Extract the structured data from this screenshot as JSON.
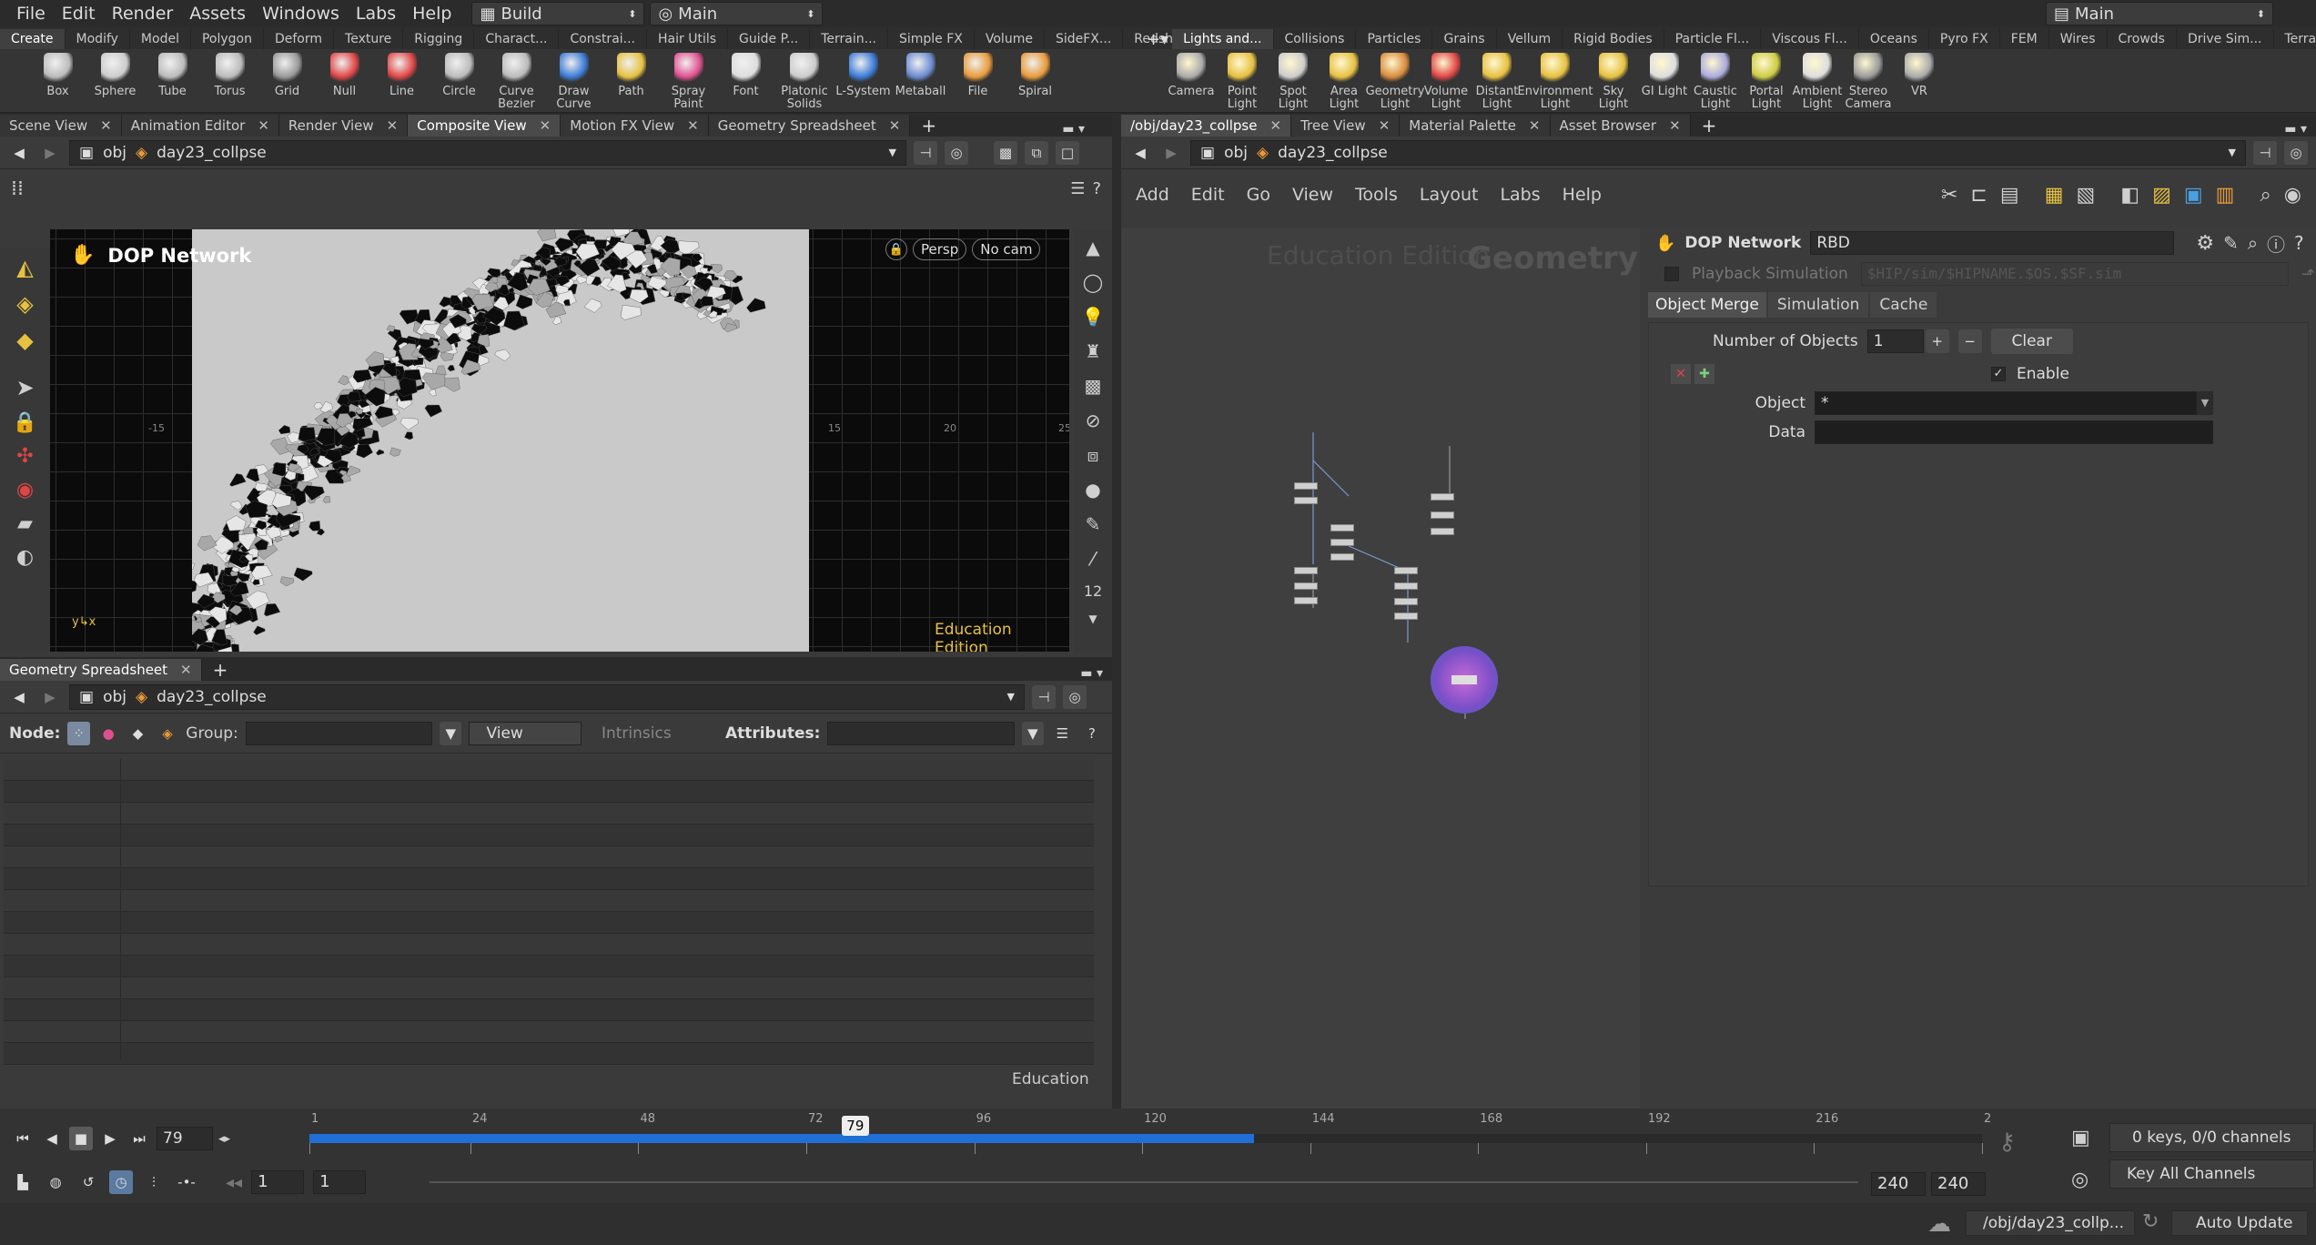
{
  "menubar": {
    "items": [
      "File",
      "Edit",
      "Render",
      "Assets",
      "Windows",
      "Labs",
      "Help"
    ],
    "desktop_build": "Build",
    "desktop_main": "Main",
    "right_desktop": "Main"
  },
  "shelf": {
    "left_tabs": [
      "Create",
      "Modify",
      "Model",
      "Polygon",
      "Deform",
      "Texture",
      "Rigging",
      "Charact...",
      "Constrai...",
      "Hair Utils",
      "Guide P...",
      "Terrain...",
      "Simple FX",
      "Volume",
      "SideFX...",
      "Redshift"
    ],
    "right_tabs": [
      "Lights and...",
      "Collisions",
      "Particles",
      "Grains",
      "Vellum",
      "Rigid Bodies",
      "Particle Fl...",
      "Viscous Fl...",
      "Oceans",
      "Pyro FX",
      "FEM",
      "Wires",
      "Crowds",
      "Drive Sim...",
      "Terrain FX"
    ],
    "left_tools": [
      "Box",
      "Sphere",
      "Tube",
      "Torus",
      "Grid",
      "Null",
      "Line",
      "Circle",
      "Curve Bezier",
      "Draw Curve",
      "Path",
      "Spray Paint",
      "Font",
      "Platonic Solids",
      "L-System",
      "Metaball",
      "File",
      "Spiral"
    ],
    "right_tools": [
      "Camera",
      "Point Light",
      "Spot Light",
      "Area Light",
      "Geometry Light",
      "Volume Light",
      "Distant Light",
      "Environment Light",
      "Sky Light",
      "GI Light",
      "Caustic Light",
      "Portal Light",
      "Ambient Light",
      "Stereo Camera",
      "VR"
    ]
  },
  "left_panes": {
    "tabs": [
      "Scene View",
      "Animation Editor",
      "Render View",
      "Composite View",
      "Motion FX View",
      "Geometry Spreadsheet"
    ],
    "path_obj": "obj",
    "path_node": "day23_collpse"
  },
  "viewport": {
    "title": "DOP Network",
    "persp": "Persp",
    "cam": "No cam",
    "edition": "Education Edition",
    "axis_labels": [
      "-15",
      "15",
      "20",
      "25"
    ]
  },
  "spreadsheet": {
    "tab": "Geometry Spreadsheet",
    "path_obj": "obj",
    "path_node": "day23_collpse",
    "node_label": "Node:",
    "group_label": "Group:",
    "view_label": "View",
    "intrinsics_label": "Intrinsics",
    "attributes_label": "Attributes:",
    "edition": "Education"
  },
  "right_panes": {
    "tabs": [
      "/obj/day23_collpse",
      "Tree View",
      "Material Palette",
      "Asset Browser"
    ],
    "path_obj": "obj",
    "path_node": "day23_collpse",
    "menu": [
      "Add",
      "Edit",
      "Go",
      "View",
      "Tools",
      "Layout",
      "Labs",
      "Help"
    ],
    "watermark_edition": "Education Edition",
    "watermark_context": "Geometry"
  },
  "params": {
    "type_label": "DOP Network",
    "name": "RBD",
    "playback_label": "Playback Simulation",
    "playback_path": "$HIP/sim/$HIPNAME.$OS.$SF.sim",
    "tabs": [
      "Object Merge",
      "Simulation",
      "Cache"
    ],
    "num_objects_label": "Number of Objects",
    "num_objects": "1",
    "clear_label": "Clear",
    "enable_label": "Enable",
    "object_label": "Object",
    "object_value": "*",
    "data_label": "Data"
  },
  "timeline": {
    "frame": "79",
    "ticks": [
      "1",
      "24",
      "48",
      "72",
      "96",
      "120",
      "144",
      "168",
      "192",
      "216",
      "2"
    ],
    "range_start": "1",
    "range_start2": "1",
    "range_end": "240",
    "range_end2": "240",
    "keys": "0 keys, 0/0 channels",
    "key_all": "Key All Channels",
    "progress": 0.565
  },
  "statusbar": {
    "path": "/obj/day23_collp...",
    "update": "Auto Update"
  },
  "colors": {
    "timeline_blue": "#1f6fd6",
    "node_selected": "#9a5ad6"
  }
}
